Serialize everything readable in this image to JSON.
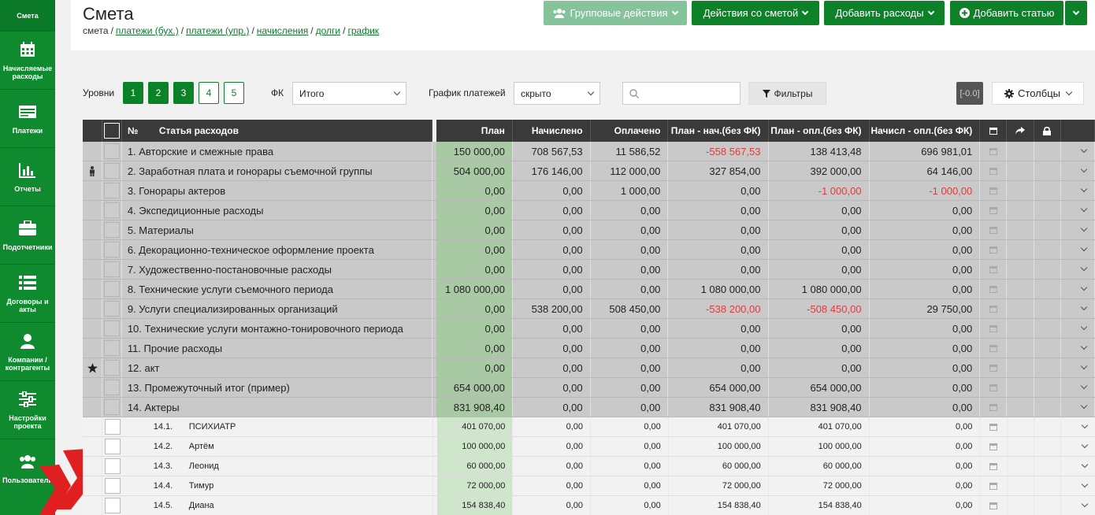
{
  "sidebar": {
    "items": [
      {
        "label": "Смета",
        "icon": "none"
      },
      {
        "label": "Начисляемые расходы",
        "icon": "calendar-icon"
      },
      {
        "label": "Платежи",
        "icon": "card-icon"
      },
      {
        "label": "Отчеты",
        "icon": "bar-chart-icon"
      },
      {
        "label": "Подотчетники",
        "icon": "briefcase-icon"
      },
      {
        "label": "Договоры и акты",
        "icon": "list-icon"
      },
      {
        "label": "Компании / контрагенты",
        "icon": "user-icon"
      },
      {
        "label": "Настройки проекта",
        "icon": "sliders-icon"
      },
      {
        "label": "Пользователи",
        "icon": "users-icon"
      }
    ]
  },
  "header": {
    "title": "Смета",
    "breadcrumb": {
      "current": "смета",
      "links": [
        "платежи (бух.)",
        "платежи (упр.)",
        "начисления",
        "долги",
        "график"
      ],
      "separator": "/"
    },
    "buttons": {
      "group_actions": "Групповые действия",
      "estimate_actions": "Действия со сметой",
      "add_expenses": "Добавить расходы",
      "add_item": "Добавить статью"
    }
  },
  "filters": {
    "levels_label": "Уровни",
    "levels": [
      "1",
      "2",
      "3",
      "4",
      "5"
    ],
    "fk_label": "ФК",
    "fk_value": "Итого",
    "schedule_label": "График платежей",
    "schedule_value": "скрыто",
    "filters_button": "Фильтры",
    "range_badge": "[-0.0]",
    "columns_button": "Столбцы"
  },
  "table": {
    "columns": {
      "num": "№",
      "name": "Статья расходов",
      "plan": "План",
      "accrued": "Начислено",
      "paid": "Оплачено",
      "plan_acc": "План - нач.(без ФК)",
      "plan_paid": "План - опл.(без ФК)",
      "acc_paid": "Начисл - опл.(без ФК)"
    },
    "rows": [
      {
        "type": "main",
        "icon": "",
        "name": "1. Авторские и смежные права",
        "plan": "150 000,00",
        "accrued": "708 567,53",
        "paid": "11 586,52",
        "plan_acc": "-558 567,53",
        "plan_paid": "138 413,48",
        "acc_paid": "696 981,01",
        "neg": [
          "plan_acc"
        ]
      },
      {
        "type": "main",
        "icon": "person",
        "name": "2. Заработная плата и гонорары съемочной группы",
        "plan": "504 000,00",
        "accrued": "176 146,00",
        "paid": "112 000,00",
        "plan_acc": "327 854,00",
        "plan_paid": "392 000,00",
        "acc_paid": "64 146,00",
        "neg": []
      },
      {
        "type": "main",
        "icon": "",
        "name": "3. Гонорары актеров",
        "plan": "0,00",
        "accrued": "0,00",
        "paid": "1 000,00",
        "plan_acc": "0,00",
        "plan_paid": "-1 000,00",
        "acc_paid": "-1 000,00",
        "neg": [
          "plan_paid",
          "acc_paid"
        ]
      },
      {
        "type": "main",
        "icon": "",
        "name": "4. Экспедиционные расходы",
        "plan": "0,00",
        "accrued": "0,00",
        "paid": "0,00",
        "plan_acc": "0,00",
        "plan_paid": "0,00",
        "acc_paid": "0,00",
        "neg": []
      },
      {
        "type": "main",
        "icon": "",
        "name": "5. Материалы",
        "plan": "0,00",
        "accrued": "0,00",
        "paid": "0,00",
        "plan_acc": "0,00",
        "plan_paid": "0,00",
        "acc_paid": "0,00",
        "neg": []
      },
      {
        "type": "main",
        "icon": "",
        "name": "6. Декорационно-техническое оформление проекта",
        "plan": "0,00",
        "accrued": "0,00",
        "paid": "0,00",
        "plan_acc": "0,00",
        "plan_paid": "0,00",
        "acc_paid": "0,00",
        "neg": []
      },
      {
        "type": "main",
        "icon": "",
        "name": "7. Художественно-постановочные расходы",
        "plan": "0,00",
        "accrued": "0,00",
        "paid": "0,00",
        "plan_acc": "0,00",
        "plan_paid": "0,00",
        "acc_paid": "0,00",
        "neg": []
      },
      {
        "type": "main",
        "icon": "",
        "name": "8. Технические услуги съемочного периода",
        "plan": "1 080 000,00",
        "accrued": "0,00",
        "paid": "0,00",
        "plan_acc": "1 080 000,00",
        "plan_paid": "1 080 000,00",
        "acc_paid": "0,00",
        "neg": []
      },
      {
        "type": "main",
        "icon": "",
        "name": "9. Услуги специализированных организаций",
        "plan": "0,00",
        "accrued": "538 200,00",
        "paid": "508 450,00",
        "plan_acc": "-538 200,00",
        "plan_paid": "-508 450,00",
        "acc_paid": "29 750,00",
        "neg": [
          "plan_acc",
          "plan_paid"
        ]
      },
      {
        "type": "main",
        "icon": "",
        "name": "10. Технические услуги монтажно-тонировочного периода",
        "plan": "0,00",
        "accrued": "0,00",
        "paid": "0,00",
        "plan_acc": "0,00",
        "plan_paid": "0,00",
        "acc_paid": "0,00",
        "neg": []
      },
      {
        "type": "main",
        "icon": "",
        "name": "11. Прочие расходы",
        "plan": "0,00",
        "accrued": "0,00",
        "paid": "0,00",
        "plan_acc": "0,00",
        "plan_paid": "0,00",
        "acc_paid": "0,00",
        "neg": []
      },
      {
        "type": "main",
        "icon": "star",
        "name": "12. акт",
        "plan": "0,00",
        "accrued": "0,00",
        "paid": "0,00",
        "plan_acc": "0,00",
        "plan_paid": "0,00",
        "acc_paid": "0,00",
        "neg": []
      },
      {
        "type": "main",
        "icon": "",
        "name": "13. Промежуточный итог (пример)",
        "plan": "654 000,00",
        "accrued": "0,00",
        "paid": "0,00",
        "plan_acc": "654 000,00",
        "plan_paid": "654 000,00",
        "acc_paid": "0,00",
        "neg": []
      },
      {
        "type": "main",
        "icon": "",
        "name": "14. Актеры",
        "plan": "831 908,40",
        "accrued": "0,00",
        "paid": "0,00",
        "plan_acc": "831 908,40",
        "plan_paid": "831 908,40",
        "acc_paid": "0,00",
        "neg": []
      },
      {
        "type": "sub",
        "icon": "",
        "num": "14.1.",
        "name": "ПСИХИАТР",
        "plan": "401 070,00",
        "accrued": "0,00",
        "paid": "0,00",
        "plan_acc": "401 070,00",
        "plan_paid": "401 070,00",
        "acc_paid": "0,00",
        "neg": []
      },
      {
        "type": "sub",
        "icon": "",
        "num": "14.2.",
        "name": "Артём",
        "plan": "100 000,00",
        "accrued": "0,00",
        "paid": "0,00",
        "plan_acc": "100 000,00",
        "plan_paid": "100 000,00",
        "acc_paid": "0,00",
        "neg": []
      },
      {
        "type": "sub",
        "icon": "",
        "num": "14.3.",
        "name": "Леонид",
        "plan": "60 000,00",
        "accrued": "0,00",
        "paid": "0,00",
        "plan_acc": "60 000,00",
        "plan_paid": "60 000,00",
        "acc_paid": "0,00",
        "neg": []
      },
      {
        "type": "sub",
        "icon": "",
        "num": "14.4.",
        "name": "Тимур",
        "plan": "72 000,00",
        "accrued": "0,00",
        "paid": "0,00",
        "plan_acc": "72 000,00",
        "plan_paid": "72 000,00",
        "acc_paid": "0,00",
        "neg": []
      },
      {
        "type": "sub",
        "icon": "",
        "num": "14.5.",
        "name": "Диана",
        "plan": "154 838,40",
        "accrued": "0,00",
        "paid": "0,00",
        "plan_acc": "154 838,40",
        "plan_paid": "154 838,40",
        "acc_paid": "0,00",
        "neg": []
      }
    ]
  },
  "colors": {
    "brand": "#0d8128",
    "sidebar": "#0f8a2f",
    "negative": "#e23b3b",
    "plan_main": "#a9c8a4",
    "plan_sub": "#d0e6cc"
  }
}
